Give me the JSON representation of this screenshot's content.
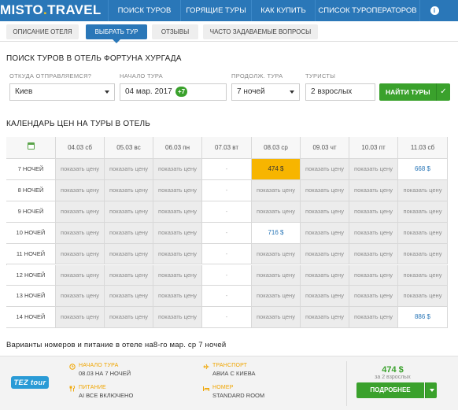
{
  "logo": {
    "part1": "MISTO",
    "dot": ".",
    "part2": "TRAVEL"
  },
  "nav": {
    "items": [
      "ПОИСК ТУРОВ",
      "ГОРЯЩИЕ ТУРЫ",
      "КАК КУПИТЬ",
      "СПИСОК ТУРОПЕРАТОРОВ"
    ],
    "info_glyph": "i"
  },
  "tabs": [
    "ОПИСАНИЕ ОТЕЛЯ",
    "ВЫБРАТЬ ТУР",
    "ОТЗЫВЫ",
    "ЧАСТО ЗАДАВАЕМЫЕ ВОПРОСЫ"
  ],
  "tabs_active_index": 1,
  "search": {
    "title": "ПОИСК ТУРОВ В ОТЕЛЬ ФОРТУНА ХУРГАДА",
    "from_label": "ОТКУДА ОТПРАВЛЯЕМСЯ?",
    "from_value": "Киев",
    "start_label": "НАЧАЛО ТУРА",
    "start_value": "04 мар. 2017",
    "start_badge": "+7",
    "duration_label": "ПРОДОЛЖ. ТУРА",
    "duration_value": "7 ночей",
    "tourists_label": "ТУРИСТЫ",
    "tourists_value": "2 взрослых",
    "find_button": "НАЙТИ ТУРЫ",
    "find_icon": "✓"
  },
  "calendar": {
    "title": "КАЛЕНДАРЬ ЦЕН НА ТУРЫ В ОТЕЛЬ",
    "dates": [
      "04.03 сб",
      "05.03 вс",
      "06.03 пн",
      "07.03 вт",
      "08.03 ср",
      "09.03 чт",
      "10.03 пт",
      "11.03 сб"
    ],
    "rows": [
      {
        "label": "7 НОЧЕЙ",
        "cells": [
          "показать цену",
          "показать цену",
          "показать цену",
          "-",
          "474 $",
          "показать цену",
          "показать цену",
          "668 $"
        ]
      },
      {
        "label": "8 НОЧЕЙ",
        "cells": [
          "показать цену",
          "показать цену",
          "показать цену",
          "-",
          "показать цену",
          "показать цену",
          "показать цену",
          "показать цену"
        ]
      },
      {
        "label": "9 НОЧЕЙ",
        "cells": [
          "показать цену",
          "показать цену",
          "показать цену",
          "-",
          "показать цену",
          "показать цену",
          "показать цену",
          "показать цену"
        ]
      },
      {
        "label": "10 НОЧЕЙ",
        "cells": [
          "показать цену",
          "показать цену",
          "показать цену",
          "-",
          "716 $",
          "показать цену",
          "показать цену",
          "показать цену"
        ]
      },
      {
        "label": "11 НОЧЕЙ",
        "cells": [
          "показать цену",
          "показать цену",
          "показать цену",
          "-",
          "показать цену",
          "показать цену",
          "показать цену",
          "показать цену"
        ]
      },
      {
        "label": "12 НОЧЕЙ",
        "cells": [
          "показать цену",
          "показать цену",
          "показать цену",
          "-",
          "показать цену",
          "показать цену",
          "показать цену",
          "показать цену"
        ]
      },
      {
        "label": "13 НОЧЕЙ",
        "cells": [
          "показать цену",
          "показать цену",
          "показать цену",
          "-",
          "показать цену",
          "показать цену",
          "показать цену",
          "показать цену"
        ]
      },
      {
        "label": "14 НОЧЕЙ",
        "cells": [
          "показать цену",
          "показать цену",
          "показать цену",
          "-",
          "показать цену",
          "показать цену",
          "показать цену",
          "886 $"
        ]
      }
    ],
    "highlight": {
      "row": 0,
      "col": 4
    }
  },
  "offer": {
    "title": "Варианты номеров и питание в отеле на8-го мар. ср 7 ночей",
    "operator_logo": "TEZ tour",
    "start_label": "НАЧАЛО ТУРА",
    "start_value": "08.03 НА 7 НОЧЕЙ",
    "transport_label": "ТРАНСПОРТ",
    "transport_value": "АВИА С КИЕВА",
    "meal_label": "ПИТАНИЕ",
    "meal_value": "AI ВСЕ ВКЛЮЧЕНО",
    "room_label": "НОМЕР",
    "room_value": "STANDARD ROOM",
    "price": "474 $",
    "price_for": "за 2 взрослых",
    "more_button": "ПОДРОБНЕЕ"
  },
  "colors": {
    "brand_blue": "#2a77b8",
    "green": "#3aa12c",
    "highlight": "#f7b500",
    "accent_orange": "#f0a500"
  }
}
